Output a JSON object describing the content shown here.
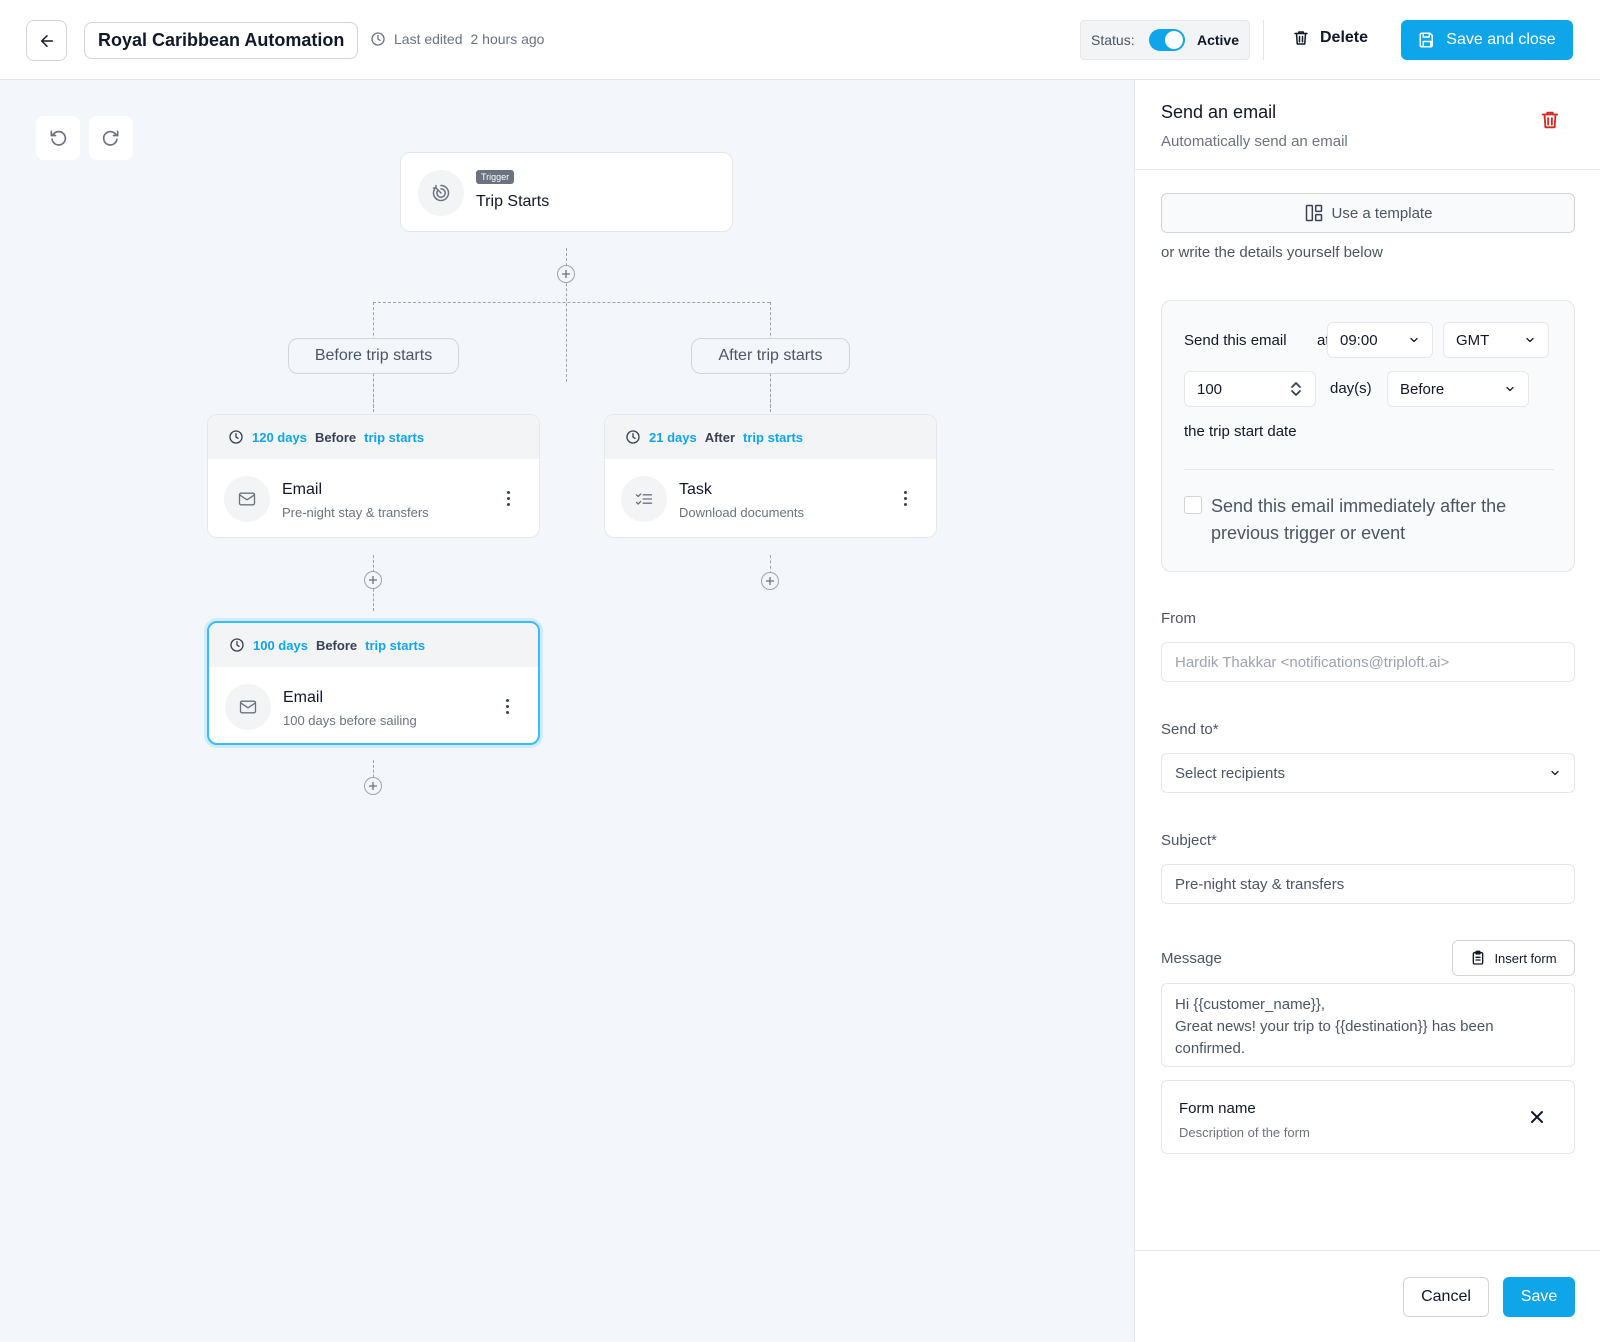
{
  "header": {
    "title": "Royal Caribbean Automation",
    "last_edited_label": "Last edited",
    "last_edited_value": "2 hours ago",
    "status_label": "Status:",
    "status_value": "Active",
    "status_on": true,
    "delete_label": "Delete",
    "save_close_label": "Save and close"
  },
  "canvas": {
    "trigger": {
      "tag": "Trigger",
      "name": "Trip Starts"
    },
    "branches": [
      {
        "label": "Before trip starts"
      },
      {
        "label": "After trip starts"
      }
    ],
    "steps": [
      {
        "days": "120 days",
        "relation": "Before",
        "reference": "trip starts",
        "type": "Email",
        "subtitle": "Pre-night stay & transfers",
        "icon": "mail-icon"
      },
      {
        "days": "21 days",
        "relation": "After",
        "reference": "trip starts",
        "type": "Task",
        "subtitle": "Download documents",
        "icon": "checklist-icon"
      },
      {
        "days": "100 days",
        "relation": "Before",
        "reference": "trip starts",
        "type": "Email",
        "subtitle": "100 days before sailing",
        "icon": "mail-icon",
        "selected": true
      }
    ]
  },
  "panel": {
    "title": "Send an email",
    "subtitle": "Automatically send an email",
    "use_template_label": "Use a template",
    "or_write_text": "or write the details yourself below",
    "schedule": {
      "send_text": "Send this email",
      "at_text": "at",
      "time_value": "09:00",
      "timezone_value": "GMT",
      "days_value": "100",
      "days_unit": "day(s)",
      "relation_value": "Before",
      "anchor_text": "the trip start date",
      "immediate_label": "Send this email immediately after the previous trigger or event",
      "immediate_checked": false
    },
    "from": {
      "label": "From",
      "value": "Hardik Thakkar <notifications@triploft.ai>"
    },
    "send_to": {
      "label": "Send to*",
      "placeholder": "Select recipients"
    },
    "subject": {
      "label": "Subject*",
      "value": "Pre-night stay & transfers"
    },
    "message": {
      "label": "Message",
      "insert_form_label": "Insert form",
      "line1": "Hi {{customer_name}},",
      "line2": "Great news! your trip to {{destination}} has been confirmed."
    },
    "form": {
      "name": "Form name",
      "description": "Description of the form"
    },
    "cancel_label": "Cancel",
    "save_label": "Save"
  },
  "colors": {
    "accent": "#0ea5e9",
    "danger": "#dc2626",
    "canvas_bg": "#f3f6fa"
  }
}
